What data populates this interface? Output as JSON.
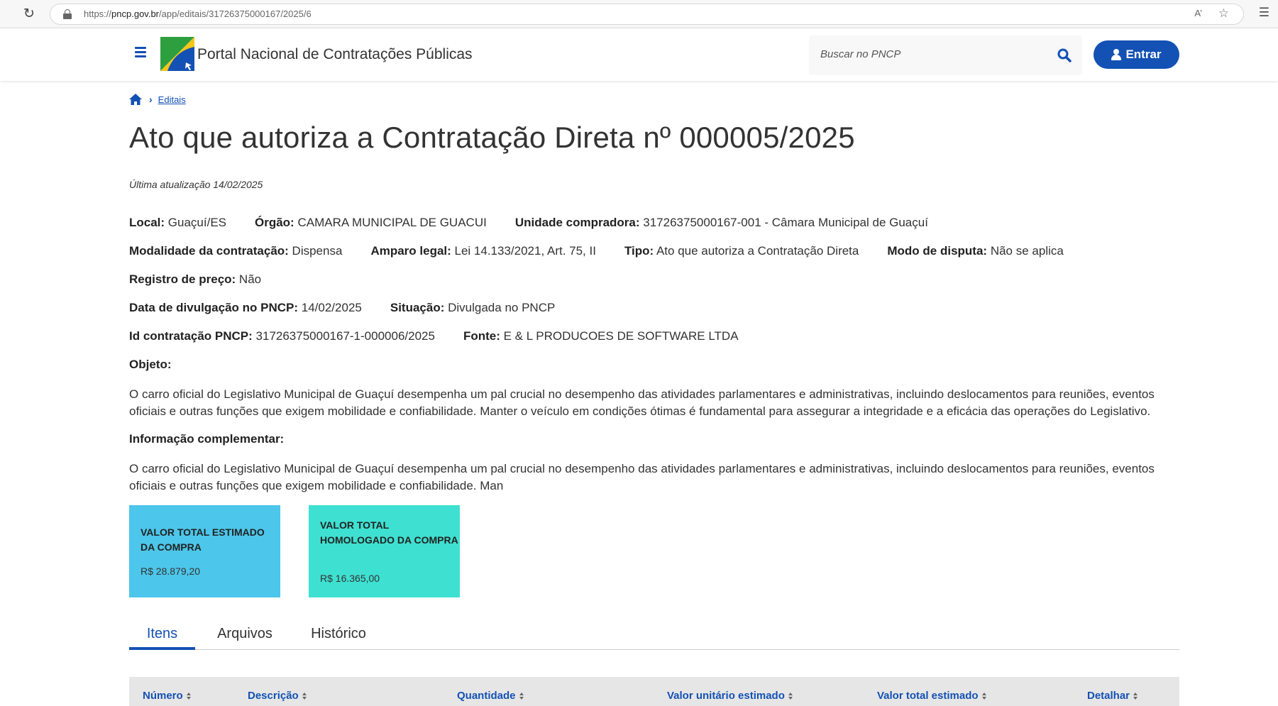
{
  "browser": {
    "url_host": "pncp.gov.br",
    "url_path": "/app/editais/31726375000167/2025/6",
    "url_prefix": "https://",
    "read_aloud": "A’"
  },
  "header": {
    "title": "Portal Nacional de Contratações Públicas",
    "search_placeholder": "Buscar no PNCP",
    "login_label": "Entrar"
  },
  "breadcrumb": {
    "link": "Editais"
  },
  "page": {
    "title": "Ato que autoriza a Contratação Direta nº 000005/2025",
    "updated": "Última atualização 14/02/2025"
  },
  "fields": {
    "local_label": "Local:",
    "local_value": " Guaçuí/ES",
    "orgao_label": "Órgão:",
    "orgao_value": " CAMARA MUNICIPAL DE GUACUI",
    "unidade_label": "Unidade compradora:",
    "unidade_value": " 31726375000167-001 - Câmara Municipal de Guaçuí",
    "modalidade_label": "Modalidade da contratação:",
    "modalidade_value": " Dispensa",
    "amparo_label": "Amparo legal:",
    "amparo_value": " Lei 14.133/2021, Art. 75, II",
    "tipo_label": "Tipo:",
    "tipo_value": " Ato que autoriza a Contratação Direta",
    "modo_label": "Modo de disputa:",
    "modo_value": " Não se aplica",
    "registro_label": "Registro de preço:",
    "registro_value": " Não",
    "data_label": "Data de divulgação no PNCP:",
    "data_value": " 14/02/2025",
    "situacao_label": "Situação:",
    "situacao_value": " Divulgada no PNCP",
    "id_label": "Id contratação PNCP:",
    "id_value": " 31726375000167-1-000006/2025",
    "fonte_label": "Fonte:",
    "fonte_value": " E & L PRODUCOES DE SOFTWARE LTDA"
  },
  "objeto": {
    "label": "Objeto:",
    "text": "O carro oficial do Legislativo Municipal de Guaçuí desempenha um pal crucial no desempenho das atividades parlamentares e administrativas, incluindo deslocamentos para reuniões, eventos oficiais e outras funções que exigem mobilidade e confiabilidade. Manter o veículo em condições ótimas é fundamental para assegurar a integridade e a eficácia das operações do Legislativo."
  },
  "complementar": {
    "label": "Informação complementar:",
    "text": "O carro oficial do Legislativo Municipal de Guaçuí desempenha um pal crucial no desempenho das atividades parlamentares e administrativas, incluindo deslocamentos para reuniões, eventos oficiais e outras funções que exigem mobilidade e confiabilidade. Man"
  },
  "cards": [
    {
      "label": "VALOR TOTAL ESTIMADO DA COMPRA",
      "value": "R$ 28.879,20"
    },
    {
      "label": "VALOR TOTAL HOMOLOGADO DA COMPRA",
      "value": "R$ 16.365,00"
    }
  ],
  "tabs": [
    {
      "label": "Itens",
      "active": true
    },
    {
      "label": "Arquivos",
      "active": false
    },
    {
      "label": "Histórico",
      "active": false
    }
  ],
  "table": {
    "headers": [
      "Número",
      "Descrição",
      "Quantidade",
      "Valor unitário estimado",
      "Valor total estimado",
      "Detalhar"
    ]
  },
  "colors": {
    "brand_blue": "#1351b4",
    "card_blue": "#4cc6ea",
    "card_teal": "#3ee0d1"
  }
}
